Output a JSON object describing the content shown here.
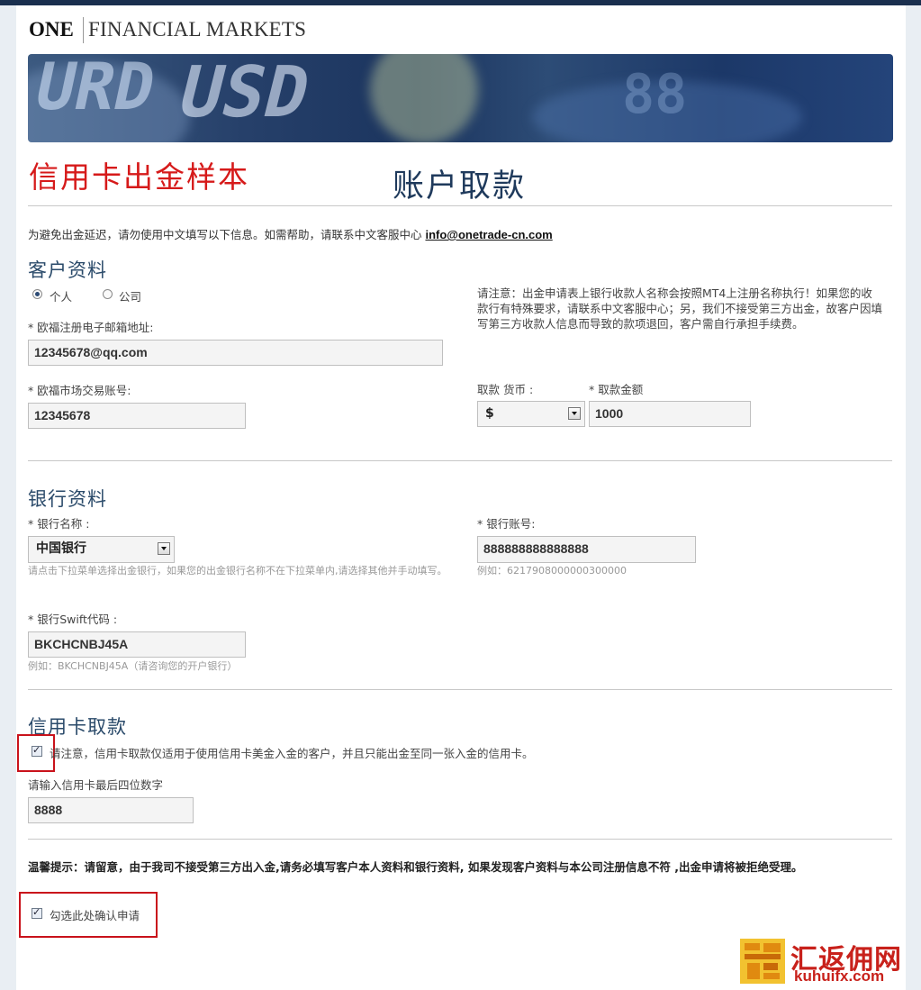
{
  "brand": {
    "one": "ONE",
    "name": "FINANCIAL MARKETS"
  },
  "banner": {
    "ticker_text_1": "URD",
    "ticker_text_2": "USD"
  },
  "titles": {
    "sample": "信用卡出金样本",
    "main": "账户取款"
  },
  "notice": {
    "text": "为避免出金延迟，请勿使用中文填写以下信息。如需帮助，请联系中文客服中心 ",
    "email": "info@onetrade-cn.com"
  },
  "customer": {
    "title": "客户资料",
    "radio_personal": "个人",
    "radio_company": "公司",
    "email_label": "* 欧福注册电子邮箱地址:",
    "email_value": "12345678@qq.com",
    "account_label": "* 欧福市场交易账号:",
    "account_value": "12345678",
    "note": "请注意：出金申请表上银行收款人名称会按照MT4上注册名称执行！如果您的收款行有特殊要求，请联系中文客服中心；另，我们不接受第三方出金，故客户因填写第三方收款人信息而导致的款项退回，客户需自行承担手续费。",
    "currency_label": "取款 货币 :",
    "currency_value": "$",
    "amount_label": "* 取款金额",
    "amount_value": "1000"
  },
  "bank": {
    "title": "银行资料",
    "name_label": "* 银行名称 :",
    "name_value": "中国银行",
    "name_hint": "请点击下拉菜单选择出金银行，如果您的出金银行名称不在下拉菜单内,请选择其他并手动填写。",
    "account_label": "* 银行账号:",
    "account_value": "888888888888888",
    "account_hint": "例如：6217908000000300000",
    "swift_label": "* 银行Swift代码 :",
    "swift_value": "BKCHCNBJ45A",
    "swift_hint": "例如：BKCHCNBJ45A（请咨询您的开户银行）"
  },
  "card": {
    "title": "信用卡取款",
    "agree_text": "请注意，信用卡取款仅适用于使用信用卡美金入金的客户，并且只能出金至同一张入金的信用卡。",
    "last4_label": "请输入信用卡最后四位数字",
    "last4_value": "8888"
  },
  "warning": "温馨提示：请留意，由于我司不接受第三方出入金,请务必填写客户本人资料和银行资料, 如果发现客户资料与本公司注册信息不符 ,出金申请将被拒绝受理。",
  "confirm": {
    "label": "勾选此处确认申请"
  },
  "watermark": {
    "cn": "汇返佣网",
    "url": "kuhuifx.com"
  },
  "colors": {
    "accent_red": "#d61a1a",
    "navy": "#1f3a5c",
    "highlight_box": "#c9121b"
  }
}
